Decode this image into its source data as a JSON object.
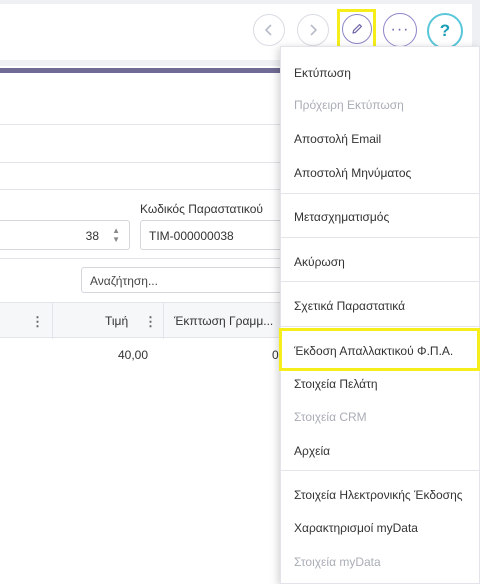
{
  "toolbar": {
    "back_icon": "chevron-left",
    "forward_icon": "chevron-right",
    "edit_icon": "pencil",
    "more_label": "···",
    "help_label": "?"
  },
  "form": {
    "code_label": "Κωδικός Παραστατικού",
    "number_value": "38",
    "code_value": "TIM-000000038",
    "search_placeholder": "Αναζήτηση..."
  },
  "grid": {
    "columns": [
      "Τιμή",
      "Έκπτωση Γραμμ..."
    ],
    "rows": [
      {
        "price": "40,00",
        "discount": "0"
      }
    ]
  },
  "menu": {
    "items": [
      {
        "label": "Εκτύπωση",
        "disabled": false
      },
      {
        "label": "Πρόχειρη Εκτύπωση",
        "disabled": true
      },
      {
        "label": "Αποστολή Email",
        "disabled": false
      },
      {
        "label": "Αποστολή Μηνύματος",
        "disabled": false
      },
      {
        "label": "Μετασχηματισμός",
        "disabled": false
      },
      {
        "label": "Ακύρωση",
        "disabled": false
      },
      {
        "label": "Σχετικά Παραστατικά",
        "disabled": false
      },
      {
        "label": "Έκδοση Απαλλακτικού Φ.Π.Α.",
        "disabled": false,
        "highlighted": true
      },
      {
        "label": "Στοιχεία Πελάτη",
        "disabled": false
      },
      {
        "label": "Στοιχεία CRM",
        "disabled": true
      },
      {
        "label": "Αρχεία",
        "disabled": false
      },
      {
        "label": "Στοιχεία Ηλεκτρονικής Έκδοσης",
        "disabled": false
      },
      {
        "label": "Χαρακτηρισμοί myData",
        "disabled": false
      },
      {
        "label": "Στοιχεία myData",
        "disabled": true
      }
    ]
  },
  "colors": {
    "accent": "#6f6b94",
    "highlight": "#f5ee1a",
    "help": "#59c7d9"
  }
}
